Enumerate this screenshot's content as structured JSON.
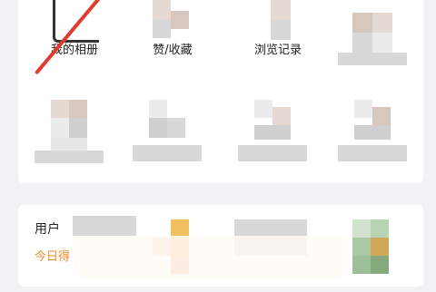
{
  "shortcuts": [
    {
      "label": "我的相册"
    },
    {
      "label": "赞/收藏"
    },
    {
      "label": "浏览记录"
    }
  ],
  "promo": {
    "title": "用户",
    "subtitle": "今日得"
  },
  "colors": {
    "annotation": "#e23a2f",
    "accent": "#f08a24"
  }
}
